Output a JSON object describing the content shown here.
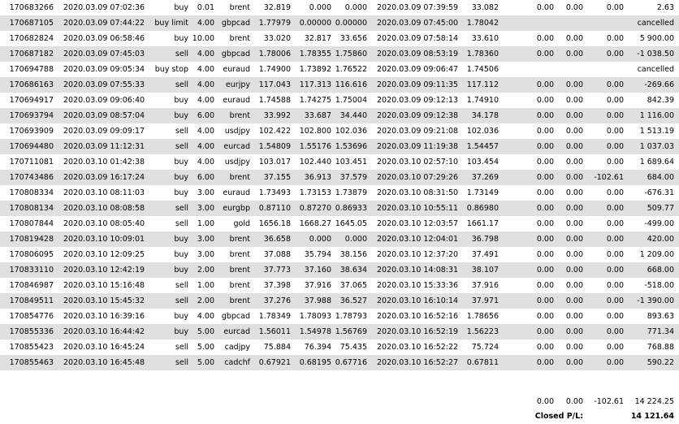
{
  "rows": [
    {
      "ticket": "170683266",
      "open_time": "2020.03.09 07:02:36",
      "type": "buy",
      "size": "0.01",
      "item": "brent",
      "price": "32.819",
      "sl": "0.000",
      "tp": "0.000",
      "close_time": "2020.03.09 07:39:59",
      "close_price": "33.082",
      "commission": "0.00",
      "taxes": "0.00",
      "swap": "0.00",
      "profit": "2.63"
    },
    {
      "ticket": "170687105",
      "open_time": "2020.03.09 07:44:22",
      "type": "buy limit",
      "size": "4.00",
      "item": "gbpcad",
      "price": "1.77979",
      "sl": "0.00000",
      "tp": "0.00000",
      "close_time": "2020.03.09 07:45:00",
      "close_price": "1.78042",
      "commission": "",
      "taxes": "",
      "swap": "",
      "profit": "cancelled"
    },
    {
      "ticket": "170682824",
      "open_time": "2020.03.09 06:58:46",
      "type": "buy",
      "size": "10.00",
      "item": "brent",
      "price": "33.020",
      "sl": "32.817",
      "tp": "33.656",
      "close_time": "2020.03.09 07:58:14",
      "close_price": "33.610",
      "commission": "0.00",
      "taxes": "0.00",
      "swap": "0.00",
      "profit": "5 900.00"
    },
    {
      "ticket": "170687182",
      "open_time": "2020.03.09 07:45:03",
      "type": "sell",
      "size": "4.00",
      "item": "gbpcad",
      "price": "1.78006",
      "sl": "1.78355",
      "tp": "1.75860",
      "close_time": "2020.03.09 08:53:19",
      "close_price": "1.78360",
      "commission": "0.00",
      "taxes": "0.00",
      "swap": "0.00",
      "profit": "-1 038.50"
    },
    {
      "ticket": "170694788",
      "open_time": "2020.03.09 09:05:34",
      "type": "buy stop",
      "size": "4.00",
      "item": "euraud",
      "price": "1.74900",
      "sl": "1.73892",
      "tp": "1.76522",
      "close_time": "2020.03.09 09:06:47",
      "close_price": "1.74506",
      "commission": "",
      "taxes": "",
      "swap": "",
      "profit": "cancelled"
    },
    {
      "ticket": "170686163",
      "open_time": "2020.03.09 07:55:33",
      "type": "sell",
      "size": "4.00",
      "item": "eurjpy",
      "price": "117.043",
      "sl": "117.313",
      "tp": "116.616",
      "close_time": "2020.03.09 09:11:35",
      "close_price": "117.112",
      "commission": "0.00",
      "taxes": "0.00",
      "swap": "0.00",
      "profit": "-269.66"
    },
    {
      "ticket": "170694917",
      "open_time": "2020.03.09 09:06:40",
      "type": "buy",
      "size": "4.00",
      "item": "euraud",
      "price": "1.74588",
      "sl": "1.74275",
      "tp": "1.75004",
      "close_time": "2020.03.09 09:12:13",
      "close_price": "1.74910",
      "commission": "0.00",
      "taxes": "0.00",
      "swap": "0.00",
      "profit": "842.39"
    },
    {
      "ticket": "170693794",
      "open_time": "2020.03.09 08:57:04",
      "type": "buy",
      "size": "6.00",
      "item": "brent",
      "price": "33.992",
      "sl": "33.687",
      "tp": "34.440",
      "close_time": "2020.03.09 09:12:38",
      "close_price": "34.178",
      "commission": "0.00",
      "taxes": "0.00",
      "swap": "0.00",
      "profit": "1 116.00"
    },
    {
      "ticket": "170693909",
      "open_time": "2020.03.09 09:09:17",
      "type": "sell",
      "size": "4.00",
      "item": "usdjpy",
      "price": "102.422",
      "sl": "102.800",
      "tp": "102.036",
      "close_time": "2020.03.09 09:21:08",
      "close_price": "102.036",
      "commission": "0.00",
      "taxes": "0.00",
      "swap": "0.00",
      "profit": "1 513.19"
    },
    {
      "ticket": "170694480",
      "open_time": "2020.03.09 11:12:31",
      "type": "sell",
      "size": "4.00",
      "item": "eurcad",
      "price": "1.54809",
      "sl": "1.55176",
      "tp": "1.53696",
      "close_time": "2020.03.09 11:19:38",
      "close_price": "1.54457",
      "commission": "0.00",
      "taxes": "0.00",
      "swap": "0.00",
      "profit": "1 037.03"
    },
    {
      "ticket": "170711081",
      "open_time": "2020.03.10 01:42:38",
      "type": "buy",
      "size": "4.00",
      "item": "usdjpy",
      "price": "103.017",
      "sl": "102.440",
      "tp": "103.451",
      "close_time": "2020.03.10 02:57:10",
      "close_price": "103.454",
      "commission": "0.00",
      "taxes": "0.00",
      "swap": "0.00",
      "profit": "1 689.64"
    },
    {
      "ticket": "170743486",
      "open_time": "2020.03.09 16:17:24",
      "type": "buy",
      "size": "6.00",
      "item": "brent",
      "price": "37.155",
      "sl": "36.913",
      "tp": "37.579",
      "close_time": "2020.03.10 07:29:26",
      "close_price": "37.269",
      "commission": "0.00",
      "taxes": "0.00",
      "swap": "-102.61",
      "profit": "684.00"
    },
    {
      "ticket": "170808334",
      "open_time": "2020.03.10 08:11:03",
      "type": "buy",
      "size": "3.00",
      "item": "euraud",
      "price": "1.73493",
      "sl": "1.73153",
      "tp": "1.73879",
      "close_time": "2020.03.10 08:31:50",
      "close_price": "1.73149",
      "commission": "0.00",
      "taxes": "0.00",
      "swap": "0.00",
      "profit": "-676.31"
    },
    {
      "ticket": "170808134",
      "open_time": "2020.03.10 08:08:58",
      "type": "sell",
      "size": "3.00",
      "item": "eurgbp",
      "price": "0.87110",
      "sl": "0.87270",
      "tp": "0.86933",
      "close_time": "2020.03.10 10:55:11",
      "close_price": "0.86980",
      "commission": "0.00",
      "taxes": "0.00",
      "swap": "0.00",
      "profit": "509.77"
    },
    {
      "ticket": "170807844",
      "open_time": "2020.03.10 08:05:40",
      "type": "sell",
      "size": "1.00",
      "item": "gold",
      "price": "1656.18",
      "sl": "1668.27",
      "tp": "1645.05",
      "close_time": "2020.03.10 12:03:57",
      "close_price": "1661.17",
      "commission": "0.00",
      "taxes": "0.00",
      "swap": "0.00",
      "profit": "-499.00"
    },
    {
      "ticket": "170819428",
      "open_time": "2020.03.10 10:09:01",
      "type": "buy",
      "size": "3.00",
      "item": "brent",
      "price": "36.658",
      "sl": "0.000",
      "tp": "0.000",
      "close_time": "2020.03.10 12:04:01",
      "close_price": "36.798",
      "commission": "0.00",
      "taxes": "0.00",
      "swap": "0.00",
      "profit": "420.00"
    },
    {
      "ticket": "170806095",
      "open_time": "2020.03.10 12:09:25",
      "type": "buy",
      "size": "3.00",
      "item": "brent",
      "price": "37.088",
      "sl": "35.794",
      "tp": "38.156",
      "close_time": "2020.03.10 12:37:20",
      "close_price": "37.491",
      "commission": "0.00",
      "taxes": "0.00",
      "swap": "0.00",
      "profit": "1 209.00"
    },
    {
      "ticket": "170833110",
      "open_time": "2020.03.10 12:42:19",
      "type": "buy",
      "size": "2.00",
      "item": "brent",
      "price": "37.773",
      "sl": "37.160",
      "tp": "38.634",
      "close_time": "2020.03.10 14:08:31",
      "close_price": "38.107",
      "commission": "0.00",
      "taxes": "0.00",
      "swap": "0.00",
      "profit": "668.00"
    },
    {
      "ticket": "170846987",
      "open_time": "2020.03.10 15:16:48",
      "type": "sell",
      "size": "1.00",
      "item": "brent",
      "price": "37.398",
      "sl": "37.916",
      "tp": "37.065",
      "close_time": "2020.03.10 15:33:36",
      "close_price": "37.916",
      "commission": "0.00",
      "taxes": "0.00",
      "swap": "0.00",
      "profit": "-518.00"
    },
    {
      "ticket": "170849511",
      "open_time": "2020.03.10 15:45:32",
      "type": "sell",
      "size": "2.00",
      "item": "brent",
      "price": "37.276",
      "sl": "37.988",
      "tp": "36.527",
      "close_time": "2020.03.10 16:10:14",
      "close_price": "37.971",
      "commission": "0.00",
      "taxes": "0.00",
      "swap": "0.00",
      "profit": "-1 390.00"
    },
    {
      "ticket": "170854776",
      "open_time": "2020.03.10 16:39:16",
      "type": "buy",
      "size": "4.00",
      "item": "gbpcad",
      "price": "1.78349",
      "sl": "1.78093",
      "tp": "1.78793",
      "close_time": "2020.03.10 16:52:16",
      "close_price": "1.78656",
      "commission": "0.00",
      "taxes": "0.00",
      "swap": "0.00",
      "profit": "893.63"
    },
    {
      "ticket": "170855336",
      "open_time": "2020.03.10 16:44:42",
      "type": "buy",
      "size": "5.00",
      "item": "eurcad",
      "price": "1.56011",
      "sl": "1.54978",
      "tp": "1.56769",
      "close_time": "2020.03.10 16:52:19",
      "close_price": "1.56223",
      "commission": "0.00",
      "taxes": "0.00",
      "swap": "0.00",
      "profit": "771.34"
    },
    {
      "ticket": "170855423",
      "open_time": "2020.03.10 16:45:24",
      "type": "sell",
      "size": "5.00",
      "item": "cadjpy",
      "price": "75.884",
      "sl": "76.394",
      "tp": "75.435",
      "close_time": "2020.03.10 16:52:22",
      "close_price": "75.724",
      "commission": "0.00",
      "taxes": "0.00",
      "swap": "0.00",
      "profit": "768.88"
    },
    {
      "ticket": "170855463",
      "open_time": "2020.03.10 16:45:48",
      "type": "sell",
      "size": "5.00",
      "item": "cadchf",
      "price": "0.67921",
      "sl": "0.68195",
      "tp": "0.67716",
      "close_time": "2020.03.10 16:52:27",
      "close_price": "0.67811",
      "commission": "0.00",
      "taxes": "0.00",
      "swap": "0.00",
      "profit": "590.22"
    }
  ],
  "summary": {
    "commission": "0.00",
    "taxes": "0.00",
    "swap": "-102.61",
    "profit": "14 224.25"
  },
  "closed_pl": {
    "label": "Closed P/L:",
    "value": "14 121.64"
  },
  "colors": {
    "alt_row": "#e0e0e0",
    "background": "#ffffff",
    "text": "#000000"
  }
}
